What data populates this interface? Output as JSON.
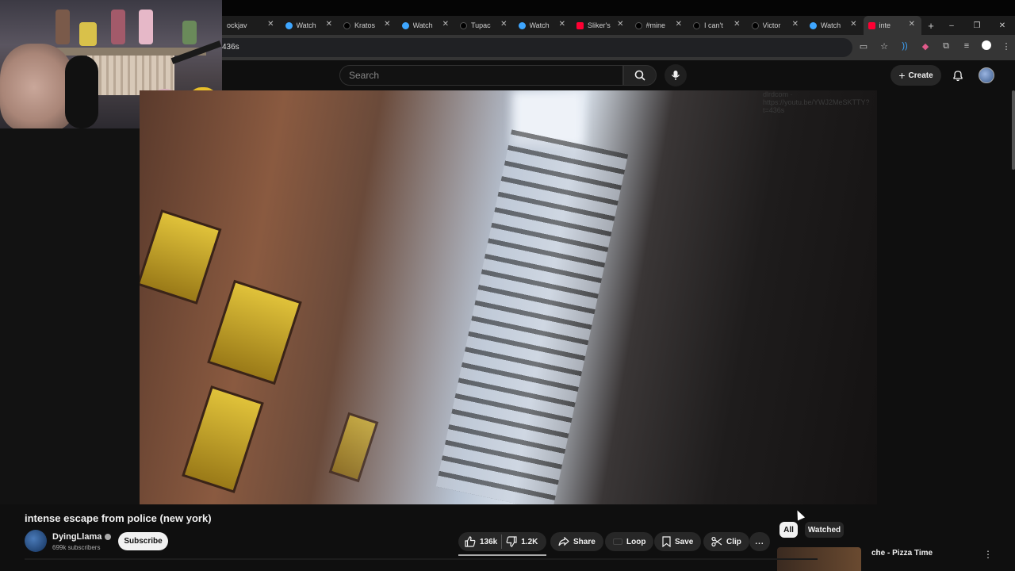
{
  "browser": {
    "tabs": [
      {
        "label": "ockjav",
        "icon": "tiktok-favicon"
      },
      {
        "label": "Watch",
        "icon": "watch-favicon"
      },
      {
        "label": "Kratos",
        "icon": "tiktok-favicon"
      },
      {
        "label": "Watch",
        "icon": "watch-favicon"
      },
      {
        "label": "Tupac",
        "icon": "tiktok-favicon"
      },
      {
        "label": "Watch",
        "icon": "watch-favicon"
      },
      {
        "label": "Sliker's",
        "icon": "youtube-favicon"
      },
      {
        "label": "#mine",
        "icon": "tiktok-favicon"
      },
      {
        "label": "I can't",
        "icon": "tiktok-favicon"
      },
      {
        "label": "Victor",
        "icon": "tiktok-favicon"
      },
      {
        "label": "Watch",
        "icon": "watch-favicon"
      },
      {
        "label": "inte",
        "icon": "youtube-favicon",
        "active": true
      }
    ],
    "new_tab": "+",
    "window_controls": {
      "minimize": "–",
      "restore": "❐",
      "close": "✕"
    },
    "url_fragment": "436s"
  },
  "youtube_header": {
    "search_placeholder": "Search",
    "create_label": "Create"
  },
  "video": {
    "title": "intense escape from police (new york)",
    "watermark": "dlrdcom · https://youtu.be/YWJ2MeSKTTY?t=436s"
  },
  "channel": {
    "name": "DyingLlama",
    "subscribers": "699k subscribers",
    "subscribe_label": "Subscribe"
  },
  "actions": {
    "likes": "136k",
    "dislikes": "1.2K",
    "share": "Share",
    "loop": "Loop",
    "save": "Save",
    "clip": "Clip",
    "more": "..."
  },
  "filters": {
    "all": "All",
    "watched": "Watched"
  },
  "recommended": {
    "title": "che - Pizza Time"
  },
  "colors": {
    "background": "#0f0f0f",
    "youtube_red": "#ff0033",
    "watch_blue": "#3ea6ff"
  }
}
